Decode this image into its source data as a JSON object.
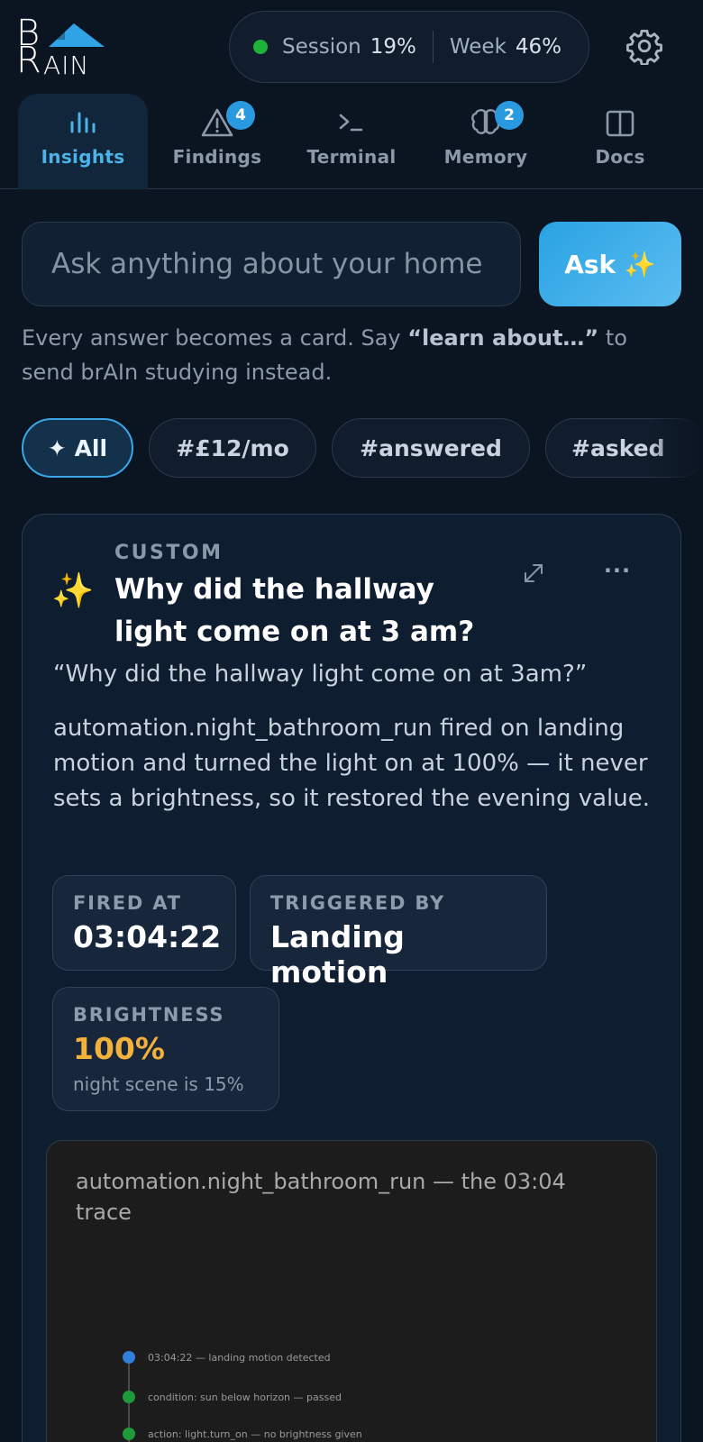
{
  "app": {
    "logo_text_top": "B",
    "logo_text_bottom": "R",
    "logo_text_rest": "AIN"
  },
  "usage": {
    "session_label": "Session",
    "session_value": "19%",
    "week_label": "Week",
    "week_value": "46%",
    "status_color": "#1fb23a"
  },
  "tabs": [
    {
      "label": "Insights",
      "icon": "bar-chart-icon",
      "active": true
    },
    {
      "label": "Findings",
      "icon": "warning-icon",
      "badge": "4"
    },
    {
      "label": "Terminal",
      "icon": "terminal-icon"
    },
    {
      "label": "Memory",
      "icon": "brain-icon",
      "badge": "2"
    },
    {
      "label": "Docs",
      "icon": "book-icon"
    }
  ],
  "ask": {
    "placeholder": "Ask anything about your home",
    "button_label": "Ask ✨",
    "hint_prefix": "Every answer becomes a card. Say ",
    "hint_bold": "“learn about…”",
    "hint_suffix": " to send brAIn studying instead."
  },
  "filters": [
    {
      "label": "✦ All",
      "active": true
    },
    {
      "label": "#£12/mo"
    },
    {
      "label": "#answered"
    },
    {
      "label": "#asked"
    }
  ],
  "card": {
    "kind": "CUSTOM",
    "icon": "✨",
    "title": "Why did the hallway light come on at 3 am?",
    "quote": "“Why did the hallway light come on at 3am?”",
    "body": "automation.night_bathroom_run fired on landing motion and turned the light on at 100% — it never sets a brightness, so it restored the evening value.",
    "more_label": "···",
    "stats": [
      {
        "label": "FIRED AT",
        "value": "03:04:22"
      },
      {
        "label": "TRIGGERED BY",
        "value": "Landing motion"
      },
      {
        "label": "BRIGHTNESS",
        "value": "100%",
        "sub": "night scene is 15%"
      }
    ],
    "trace": {
      "title": "automation.night_bathroom_run — the 03:04 trace",
      "steps": [
        {
          "text": "03:04:22 — landing motion detected",
          "color": "#2f7fdb"
        },
        {
          "text": "condition: sun below horizon — passed",
          "color": "#1e9a3a"
        },
        {
          "text": "action: light.turn_on — no brightness given",
          "color": "#1e9a3a"
        }
      ]
    }
  }
}
